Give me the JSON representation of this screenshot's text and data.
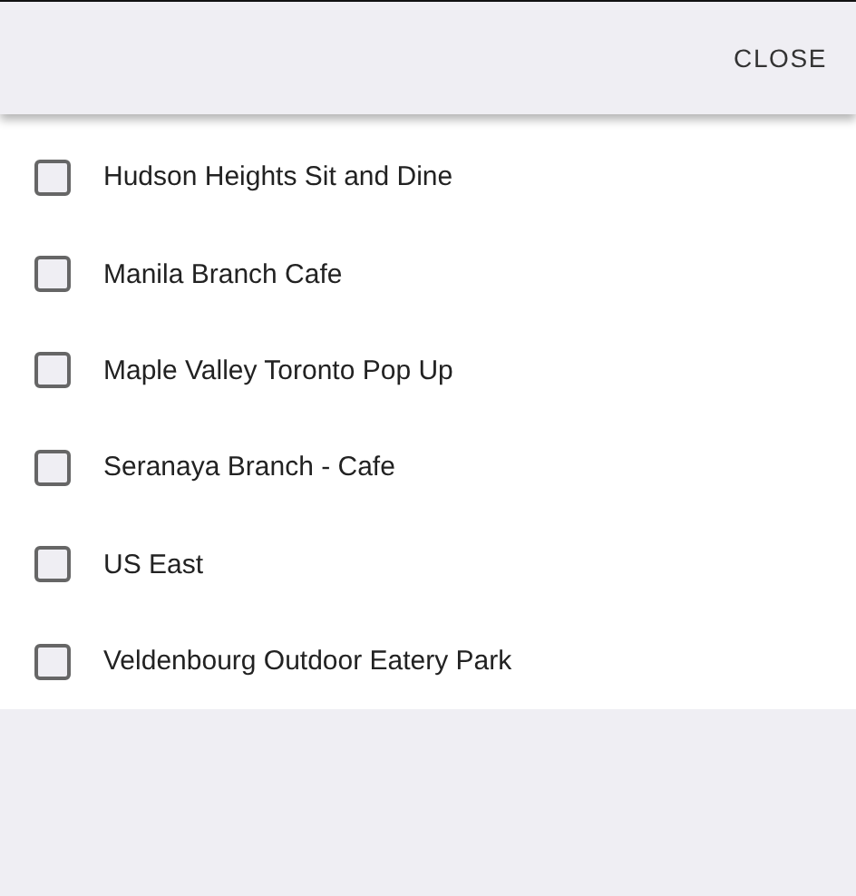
{
  "header": {
    "close_button": "CLOSE"
  },
  "items": [
    {
      "label": "Hudson Heights Sit and Dine",
      "checked": false
    },
    {
      "label": "Manila Branch Cafe",
      "checked": false
    },
    {
      "label": "Maple Valley Toronto Pop Up",
      "checked": false
    },
    {
      "label": "Seranaya Branch - Cafe",
      "checked": false
    },
    {
      "label": "US East",
      "checked": false
    },
    {
      "label": "Veldenbourg Outdoor Eatery Park",
      "checked": false
    }
  ]
}
